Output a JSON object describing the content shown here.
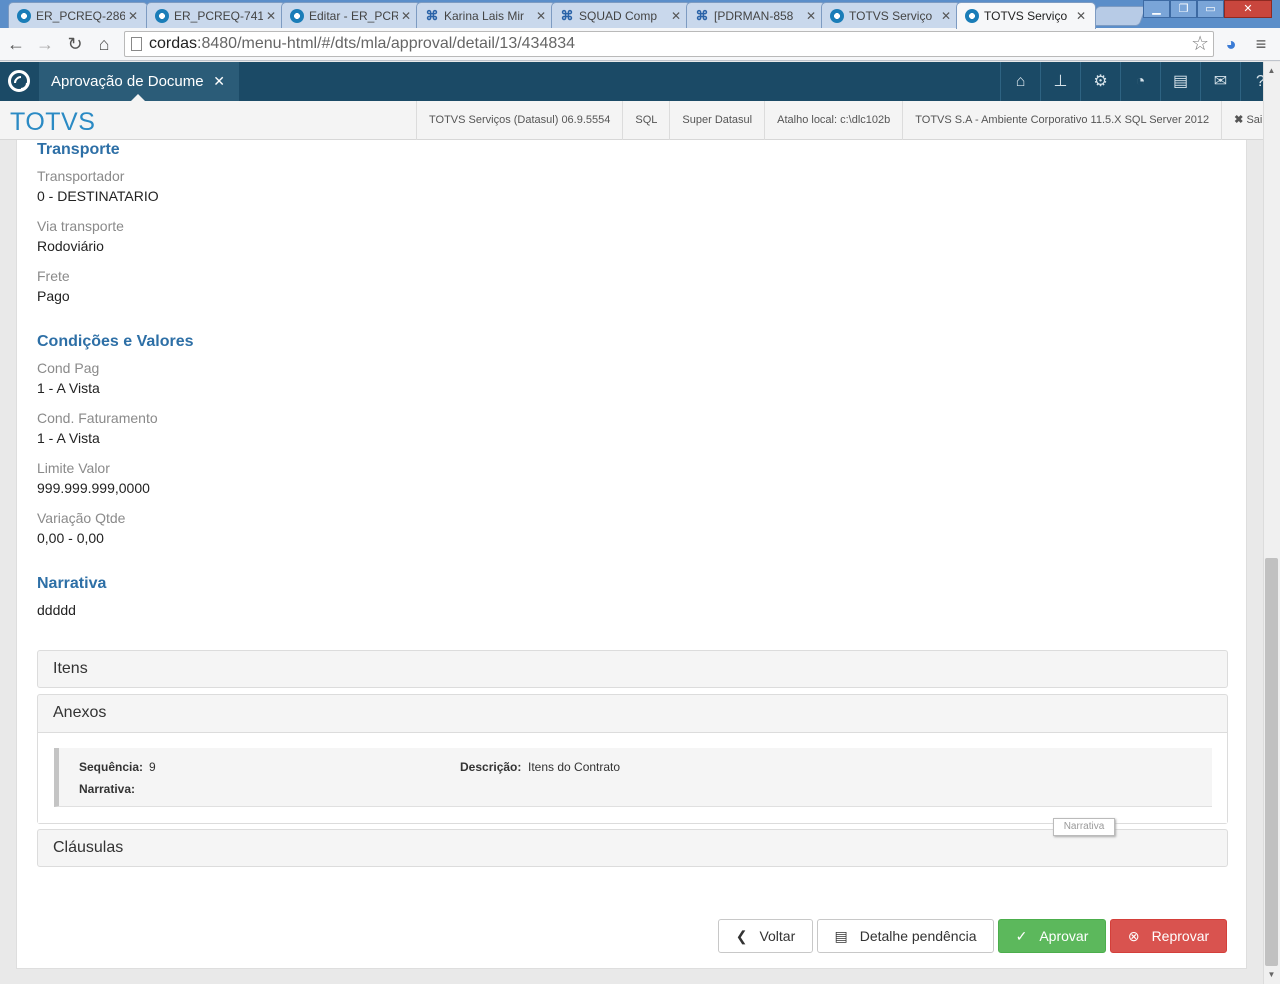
{
  "browser": {
    "tabs": [
      {
        "title": "ER_PCREQ-286",
        "icon": "totvs-icon"
      },
      {
        "title": "ER_PCREQ-741",
        "icon": "totvs-icon"
      },
      {
        "title": "Editar - ER_PCR",
        "icon": "totvs-icon"
      },
      {
        "title": "Karina Lais Mir",
        "icon": "jira-icon"
      },
      {
        "title": "SQUAD Comp",
        "icon": "jira-icon"
      },
      {
        "title": "[PDRMAN-858",
        "icon": "jira-icon"
      },
      {
        "title": "TOTVS Serviço",
        "icon": "totvs-icon"
      },
      {
        "title": "TOTVS Serviço",
        "icon": "totvs-icon"
      }
    ],
    "active_tab": 7,
    "url_host": "cordas",
    "url_path": ":8480/menu-html/#/dts/mla/approval/detail/13/434834"
  },
  "app": {
    "tab_title": "Aprovação de Docume",
    "brand": "TOTVS",
    "header_icons": [
      "home-icon",
      "sitemap-icon",
      "gear-icon",
      "dashboard-icon",
      "document-icon",
      "envelope-icon",
      "help-icon"
    ],
    "info": {
      "product": "TOTVS Serviços (Datasul) 06.9.5554",
      "db": "SQL",
      "user": "Super Datasul",
      "shortcut": "Atalho local: c:\\dlc102b",
      "environment": "TOTVS S.A - Ambiente Corporativo 11.5.X SQL Server 2012",
      "logout": "Sair"
    }
  },
  "transporte": {
    "title": "Transporte",
    "transportador_label": "Transportador",
    "transportador_value": "0 - DESTINATARIO",
    "via_label": "Via transporte",
    "via_value": "Rodoviário",
    "frete_label": "Frete",
    "frete_value": "Pago"
  },
  "condicoes": {
    "title": "Condições e Valores",
    "cond_pag_label": "Cond Pag",
    "cond_pag_value": "1 - A Vista",
    "cond_fat_label": "Cond. Faturamento",
    "cond_fat_value": "1 - A Vista",
    "limite_label": "Limite Valor",
    "limite_value": "999.999.999,0000",
    "variacao_label": "Variação Qtde",
    "variacao_value": "0,00 - 0,00"
  },
  "narrativa": {
    "title": "Narrativa",
    "value": "ddddd"
  },
  "panels": {
    "itens": "Itens",
    "anexos": "Anexos",
    "clausulas": "Cláusulas"
  },
  "anexo": {
    "sequencia_label": "Sequência:",
    "sequencia_value": "9",
    "descricao_label": "Descrição:",
    "descricao_value": "Itens do Contrato",
    "narrativa_label": "Narrativa:",
    "narrativa_value": ""
  },
  "tooltip": "Narrativa",
  "actions": {
    "voltar": "Voltar",
    "detalhe": "Detalhe pendência",
    "aprovar": "Aprovar",
    "reprovar": "Reprovar"
  },
  "colors": {
    "header_bg": "#1b4a66",
    "brand": "#2a8ac4",
    "section_title": "#2d6fa6",
    "success": "#5cb85c",
    "danger": "#d9534f"
  }
}
